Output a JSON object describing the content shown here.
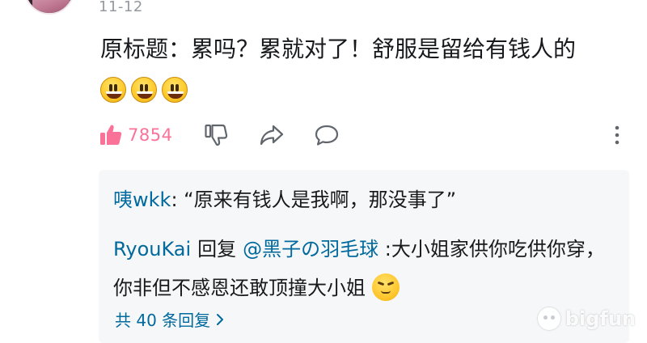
{
  "comment": {
    "date": "11-12",
    "text": "原标题：累吗？累就对了！舒服是留给有钱人的",
    "emojis": [
      "grin-emoji",
      "grin-emoji",
      "grin-emoji"
    ],
    "like_count": "7854"
  },
  "replies": {
    "first": {
      "user": "咦wkk",
      "text": ": “原来有钱人是我啊，那没事了”"
    },
    "second": {
      "user": "RyouKai",
      "action": "回复",
      "mention": "@黑子の羽毛球",
      "text": " :大小姐家供你吃供你穿，你非但不感恩还敢顶撞大小姐"
    },
    "total_label": "共 40 条回复"
  },
  "watermark": {
    "text": "bigfun"
  },
  "colors": {
    "like_pink": "#fb7299",
    "link_blue": "#00699d",
    "muted_gray": "#9499a0",
    "reply_bg": "#f6f7f8"
  }
}
